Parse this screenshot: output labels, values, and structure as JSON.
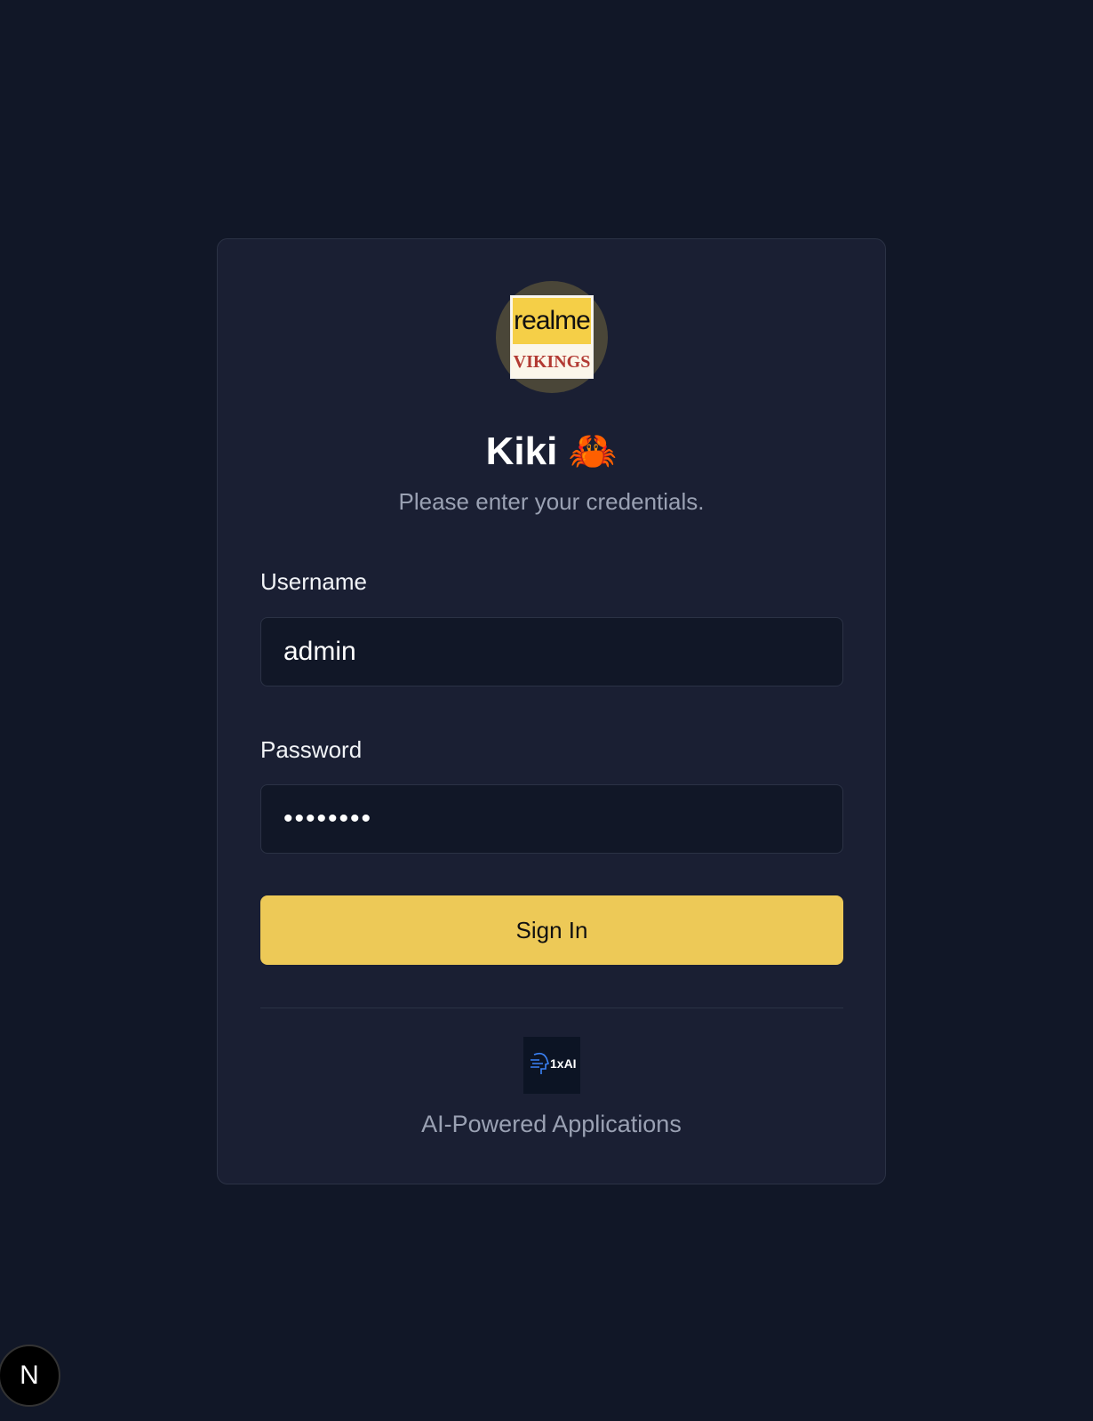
{
  "login": {
    "logo_text": {
      "top": "realme",
      "bottom": "VIKINGS"
    },
    "title": "Kiki 🦀",
    "subtitle": "Please enter your credentials.",
    "username_label": "Username",
    "username_value": "admin",
    "password_label": "Password",
    "password_value": "••••••••",
    "submit_label": "Sign In",
    "footer_logo_text": "1xAI",
    "footer_text": "AI-Powered Applications"
  },
  "dev_indicator": "N",
  "colors": {
    "background": "#111727",
    "card": "#1a1f33",
    "accent": "#edc957"
  }
}
